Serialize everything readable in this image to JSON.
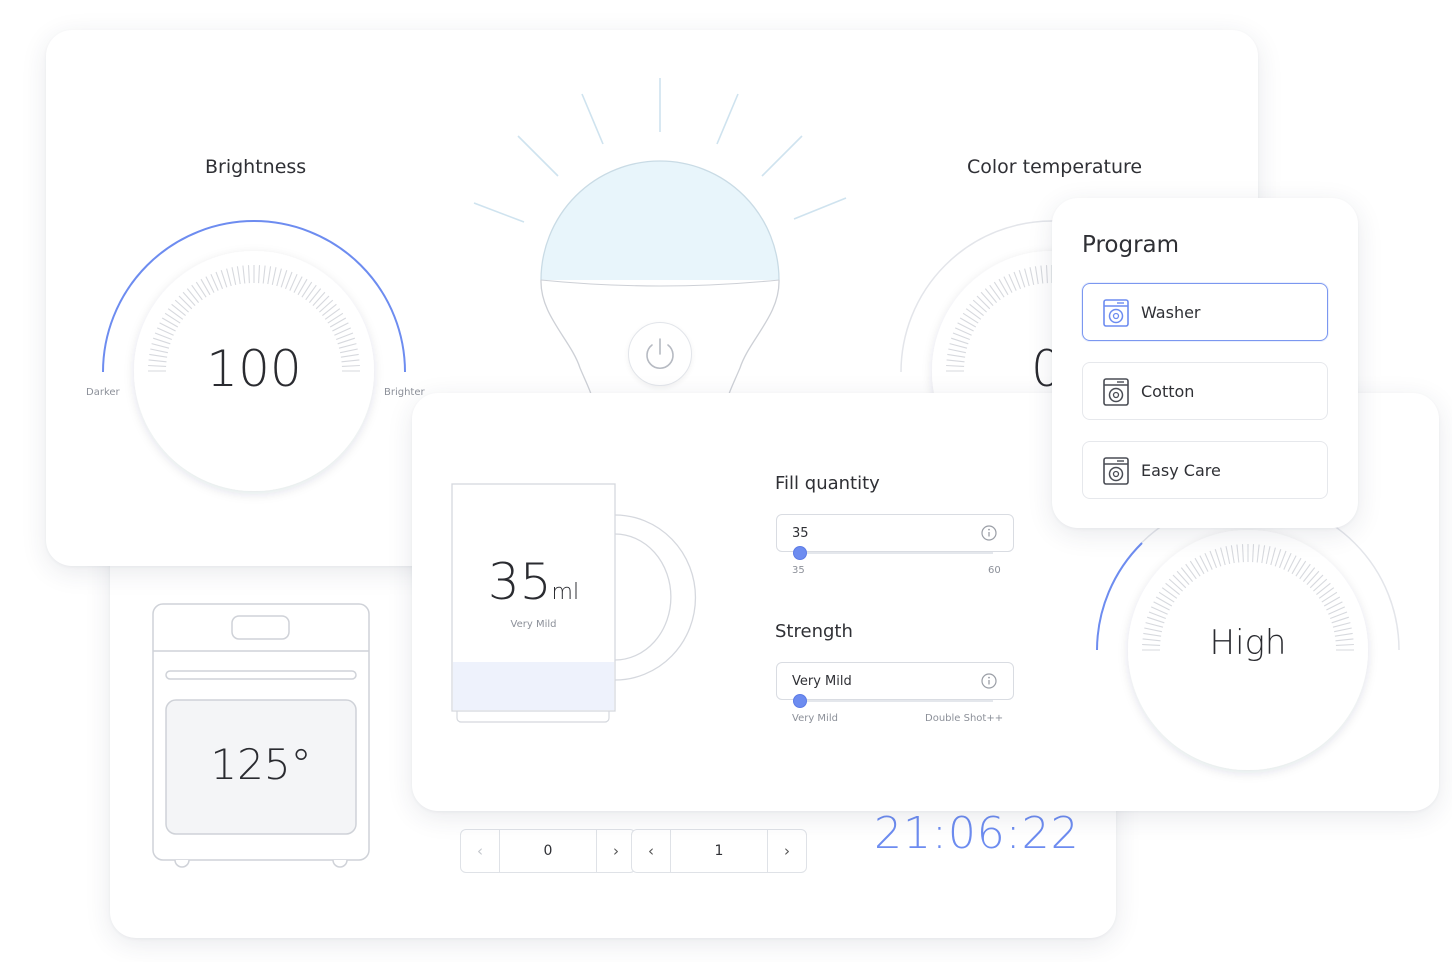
{
  "oven": {
    "temperature": "125°",
    "stepper_a": {
      "value": "0",
      "prev_icon": "chevron-left-icon",
      "next_icon": "chevron-right-icon"
    },
    "stepper_b": {
      "value": "1",
      "prev_icon": "chevron-left-icon",
      "next_icon": "chevron-right-icon"
    },
    "clock": "21:06:22"
  },
  "light": {
    "brightness": {
      "title": "Brightness",
      "value": "100",
      "min_label": "Darker",
      "max_label": "Brighter",
      "level_percent": 100
    },
    "color_temperature": {
      "title": "Color temperature",
      "value": "0"
    },
    "power_icon": "power-icon"
  },
  "coffee": {
    "amount_number": "35",
    "amount_unit": "ml",
    "strength_caption": "Very Mild",
    "fill_quantity": {
      "label": "Fill quantity",
      "value": "35",
      "min": "35",
      "max": "60"
    },
    "strength": {
      "label": "Strength",
      "value": "Very Mild",
      "min": "Very Mild",
      "max": "Double Shot++"
    },
    "info_icon": "info-icon"
  },
  "program": {
    "title": "Program",
    "items": [
      {
        "label": "Washer",
        "icon": "washing-machine-icon",
        "selected": true
      },
      {
        "label": "Cotton",
        "icon": "washing-machine-icon",
        "selected": false
      },
      {
        "label": "Easy Care",
        "icon": "washing-machine-icon",
        "selected": false
      }
    ]
  },
  "washer_gauge": {
    "value": "High"
  },
  "colors": {
    "accent": "#6d8cf0",
    "text": "#2f3035",
    "bulb_glass": "#e8f5fb",
    "bulb_rays": "#cfe3ef"
  }
}
